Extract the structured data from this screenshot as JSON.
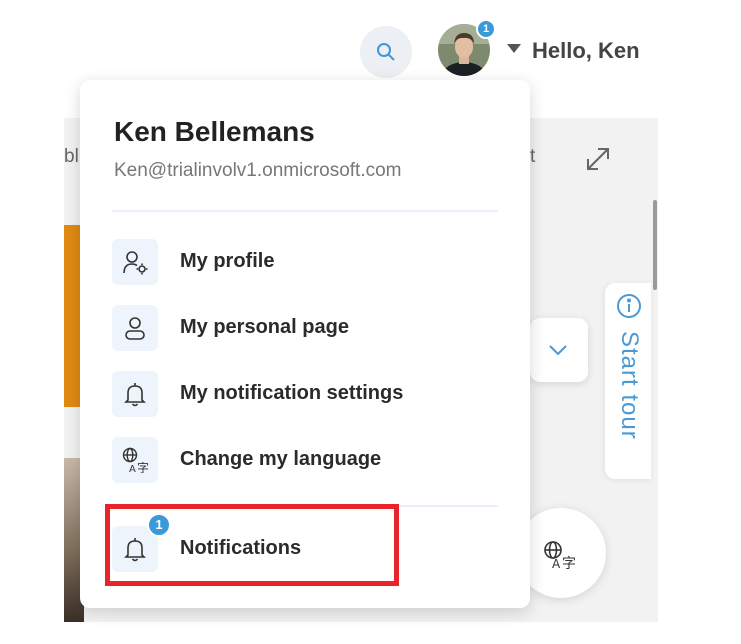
{
  "header": {
    "greeting": "Hello, Ken",
    "avatar_badge_count": "1"
  },
  "background": {
    "fragment_left": "bl",
    "fragment_right": "t"
  },
  "user_menu": {
    "name": "Ken Bellemans",
    "email": "Ken@trialinvolv1.onmicrosoft.com",
    "items": [
      {
        "label": "My profile",
        "icon": "user-settings-icon"
      },
      {
        "label": "My personal page",
        "icon": "user-icon"
      },
      {
        "label": "My notification settings",
        "icon": "bell-icon"
      },
      {
        "label": "Change my language",
        "icon": "translate-icon"
      }
    ],
    "notifications": {
      "label": "Notifications",
      "icon": "bell-icon",
      "badge_count": "1"
    }
  },
  "start_tour": {
    "label": "Start tour",
    "icon": "info-icon"
  },
  "colors": {
    "accent": "#3a9ad9",
    "highlight_border": "#e8232a",
    "orange_panel": "#e08a12"
  }
}
